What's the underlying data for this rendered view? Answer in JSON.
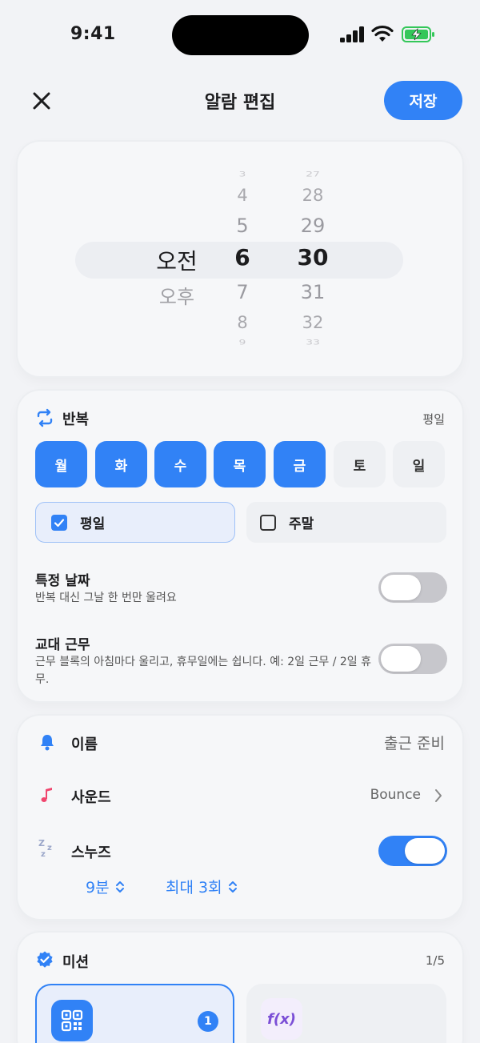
{
  "status_bar": {
    "time": "9:41"
  },
  "header": {
    "title": "알람 편집",
    "save_label": "저장"
  },
  "picker": {
    "ampm": {
      "selected": "오전",
      "other": "오후"
    },
    "hours": {
      "far_above": "3",
      "above2": "4",
      "above1": "5",
      "selected": "6",
      "below1": "7",
      "below2": "8",
      "far_below": "9"
    },
    "minutes": {
      "far_above": "27",
      "above2": "28",
      "above1": "29",
      "selected": "30",
      "below1": "31",
      "below2": "32",
      "far_below": "33"
    }
  },
  "repeat": {
    "title": "반복",
    "summary": "평일",
    "days": [
      {
        "label": "월",
        "active": true
      },
      {
        "label": "화",
        "active": true
      },
      {
        "label": "수",
        "active": true
      },
      {
        "label": "목",
        "active": true
      },
      {
        "label": "금",
        "active": true
      },
      {
        "label": "토",
        "active": false
      },
      {
        "label": "일",
        "active": false
      }
    ],
    "presets": {
      "weekdays": "평일",
      "weekend": "주말"
    },
    "specific_date": {
      "title": "특정 날짜",
      "subtitle": "반복 대신 그날 한 번만 울려요",
      "enabled": false
    },
    "shift_work": {
      "title": "교대 근무",
      "subtitle": "근무 블록의 아침마다 울리고, 휴무일에는 쉽니다. 예: 2일 근무 / 2일 휴무.",
      "enabled": false
    }
  },
  "settings": {
    "name": {
      "label": "이름",
      "value": "출근 준비"
    },
    "sound": {
      "label": "사운드",
      "value": "Bounce"
    },
    "snooze": {
      "label": "스누즈",
      "enabled": true,
      "interval": "9분",
      "max": "최대 3회"
    }
  },
  "mission": {
    "title": "미션",
    "count": "1/5",
    "tiles": [
      {
        "icon": "qr-code-icon",
        "badge": "1",
        "selected": true
      },
      {
        "icon": "fx-math-icon",
        "label": "f(x)",
        "selected": false
      }
    ]
  },
  "colors": {
    "accent": "#3182f6",
    "background": "#f2f3f6",
    "card": "#f6f7f9",
    "toggle_off": "#c7c7cc",
    "bell": "#3182f6",
    "music": "#f0466e",
    "fx": "#7b4fd6"
  }
}
